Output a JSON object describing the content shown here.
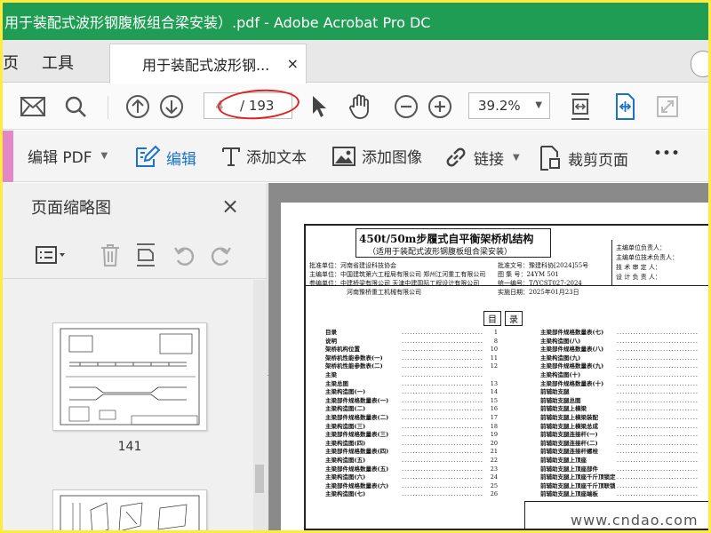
{
  "window": {
    "title": "用于装配式波形钢腹板组合梁安装）.pdf - Adobe Acrobat Pro DC"
  },
  "tabs": {
    "home_partial": "页",
    "tools": "工具",
    "document_tab": "用于装配式波形钢...",
    "document_tab_close": "×"
  },
  "toolbar": {
    "current_page": "4",
    "total_pages": "/ 193",
    "zoom": "39.2%"
  },
  "edit_toolbar": {
    "edit_pdf": "编辑 PDF",
    "edit": "编辑",
    "add_text": "添加文本",
    "add_image": "添加图像",
    "link": "链接",
    "crop_page": "裁剪页面",
    "more": "•••"
  },
  "sidebar": {
    "title": "页面缩略图",
    "close": "×",
    "thumbnails": [
      {
        "label": "141"
      }
    ]
  },
  "document": {
    "title": "450t/50m步履式自平衡架桥机结构",
    "subtitle": "（适用于装配式波形钢腹板组合梁安装）",
    "info_left": [
      "批准单位：河南省建设科技协会",
      "主编单位：中国建筑第六工程局有限公司 郑州江河重工有限公司",
      "参编单位：中建桥梁有限公司 天津中建国际工程设计有限公司",
      "河南豫桥重工机械有限公司"
    ],
    "info_mid": [
      "批准文号：豫建科协[2024]55号",
      "图 集 号：24YM 501",
      "统一编号：T/YCST027-2024",
      "实施日期：2025年01月23日"
    ],
    "signatures": [
      "主编单位负责人：",
      "主编单位技术负责人：",
      "技 术 审 定 人：",
      "设 计 负 责 人："
    ],
    "toc_heading": [
      "目",
      "录"
    ],
    "toc_left": [
      {
        "name": "目录",
        "num": "1"
      },
      {
        "name": "说明",
        "num": "8"
      },
      {
        "name": "架桥机构位置",
        "num": "10"
      },
      {
        "name": "架桥机性能参数表(一)",
        "num": "11"
      },
      {
        "name": "架桥机性能参数表(二)",
        "num": "12"
      },
      {
        "name": "主梁",
        "num": ""
      },
      {
        "name": "主梁总图",
        "num": "13"
      },
      {
        "name": "主梁构造图(一)",
        "num": "14"
      },
      {
        "name": "主梁部件规格数量表(一)",
        "num": "15"
      },
      {
        "name": "主梁构造图(二)",
        "num": "16"
      },
      {
        "name": "主梁部件规格数量表(二)",
        "num": "17"
      },
      {
        "name": "主梁构造图(三)",
        "num": "18"
      },
      {
        "name": "主梁部件规格数量表(三)",
        "num": "19"
      },
      {
        "name": "主梁构造图(四)",
        "num": "20"
      },
      {
        "name": "主梁部件规格数量表(四)",
        "num": "21"
      },
      {
        "name": "主梁构造图(五)",
        "num": "22"
      },
      {
        "name": "主梁部件规格数量表(五)",
        "num": "23"
      },
      {
        "name": "主梁构造图(六)",
        "num": "24"
      },
      {
        "name": "主梁部件规格数量表(六)",
        "num": "25"
      },
      {
        "name": "主梁构造图(七)",
        "num": "26"
      }
    ],
    "toc_right": [
      {
        "name": "主梁部件规格数量表(七)",
        "num": ""
      },
      {
        "name": "主梁构造图(八)",
        "num": ""
      },
      {
        "name": "主梁部件规格数量表(八)",
        "num": ""
      },
      {
        "name": "主梁构造图(九)",
        "num": ""
      },
      {
        "name": "主梁部件规格数量表(九)",
        "num": ""
      },
      {
        "name": "主梁构造图(十)",
        "num": ""
      },
      {
        "name": "主梁部件规格数量表(十)",
        "num": ""
      },
      {
        "name": "前辅助支腿",
        "num": ""
      },
      {
        "name": "前辅助支腿总图",
        "num": ""
      },
      {
        "name": "前辅助支腿上横梁",
        "num": ""
      },
      {
        "name": "前辅助支腿上横梁装配",
        "num": ""
      },
      {
        "name": "前辅助支腿上横梁总成",
        "num": ""
      },
      {
        "name": "前辅助支腿连接杆(一)",
        "num": ""
      },
      {
        "name": "前辅助支腿连接杆(二)",
        "num": ""
      },
      {
        "name": "前辅助支腿连接杆螺栓",
        "num": ""
      },
      {
        "name": "前辅助支腿上顶座",
        "num": ""
      },
      {
        "name": "前辅助支腿上顶座部件",
        "num": ""
      },
      {
        "name": "前辅助支腿上顶座千斤顶锁定",
        "num": ""
      },
      {
        "name": "前辅助支腿上顶座千斤顶联锁",
        "num": ""
      },
      {
        "name": "前辅助支腿上顶座端板",
        "num": ""
      }
    ],
    "watermark": "www.cndao.com"
  }
}
